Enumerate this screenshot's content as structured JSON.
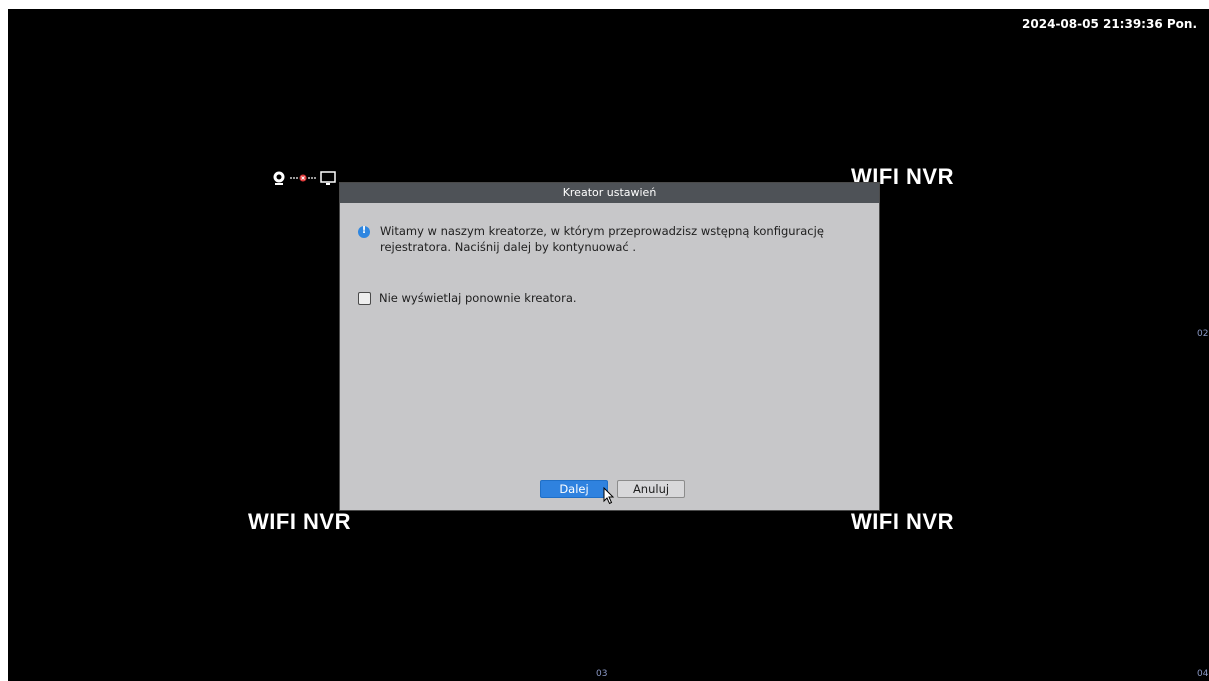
{
  "datetime": "2024-08-05 21:39:36 Pon.",
  "watermark": "WIFI NVR",
  "channels": {
    "ch2": "02",
    "ch3": "03",
    "ch4": "04"
  },
  "status_icons": [
    "camera-icon",
    "connection-error-icon",
    "monitor-icon"
  ],
  "dialog": {
    "title": "Kreator ustawień",
    "message": "Witamy w naszym kreatorze, w którym przeprowadzisz wstępną konfigurację rejestratora. Naciśnij dalej by kontynuować .",
    "checkbox_label": "Nie wyświetlaj ponownie kreatora.",
    "checkbox_checked": false,
    "next_label": "Dalej",
    "cancel_label": "Anuluj"
  },
  "colors": {
    "background": "#000000",
    "dialog_bg": "#c7c7c9",
    "titlebar": "#4e5257",
    "primary": "#2f82df",
    "info": "#2e86e0",
    "channel_label": "#8b99c6"
  }
}
